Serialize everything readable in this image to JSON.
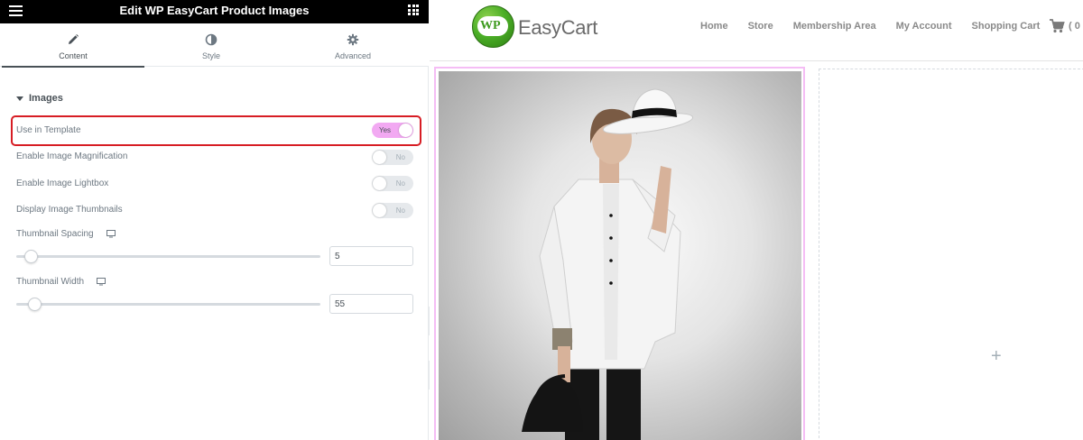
{
  "panel": {
    "title": "Edit WP EasyCart Product Images",
    "tabs": [
      {
        "label": "Content",
        "icon": "pencil-icon",
        "active": true
      },
      {
        "label": "Style",
        "icon": "contrast-icon",
        "active": false
      },
      {
        "label": "Advanced",
        "icon": "gear-icon",
        "active": false
      }
    ],
    "section": {
      "title": "Images"
    },
    "controls": {
      "use_in_template": {
        "label": "Use in Template",
        "value": "Yes",
        "enabled": true
      },
      "enable_magnification": {
        "label": "Enable Image Magnification",
        "value": "No",
        "enabled": false
      },
      "enable_lightbox": {
        "label": "Enable Image Lightbox",
        "value": "No",
        "enabled": false
      },
      "display_thumbnails": {
        "label": "Display Image Thumbnails",
        "value": "No",
        "enabled": false
      },
      "thumbnail_spacing": {
        "label": "Thumbnail Spacing",
        "value": "5",
        "icon": "desktop-icon"
      },
      "thumbnail_width": {
        "label": "Thumbnail Width",
        "value": "55",
        "icon": "desktop-icon"
      }
    },
    "colors": {
      "highlight": "#d71d24",
      "toggle_on": "#f2a9f2",
      "topbar": "#000000"
    }
  },
  "site": {
    "logo": {
      "mark": "WP",
      "text": "EasyCart"
    },
    "nav": [
      "Home",
      "Store",
      "Membership Area",
      "My Account",
      "Shopping Cart"
    ],
    "cart": {
      "icon": "cart-icon",
      "count_text": "( 0"
    },
    "empty_column": {
      "icon": "plus-icon"
    }
  }
}
